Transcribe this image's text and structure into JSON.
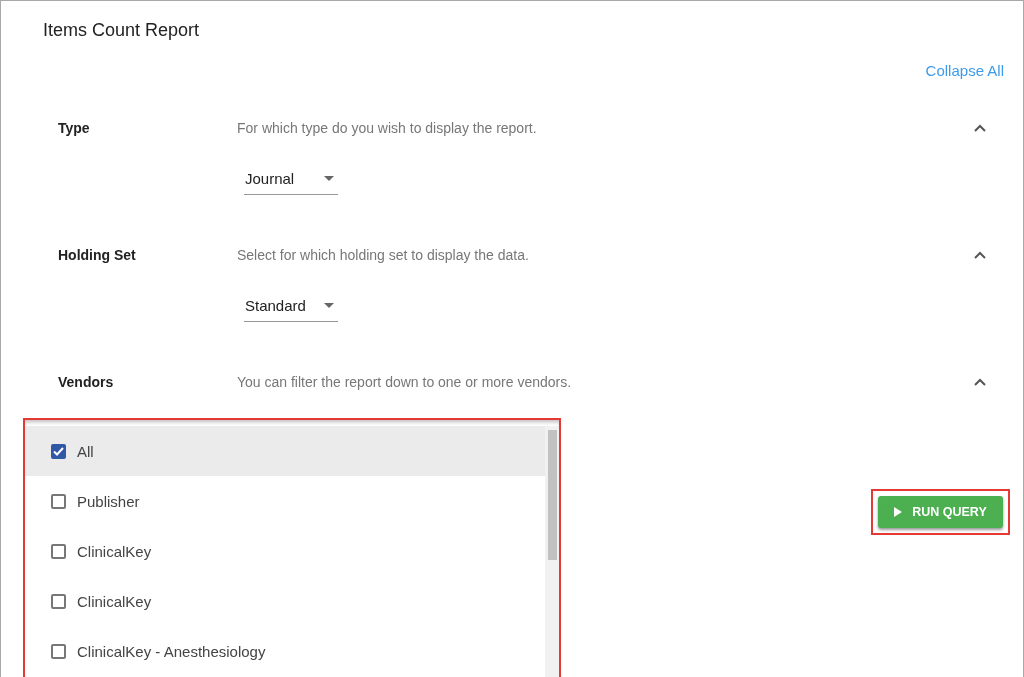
{
  "title": "Items Count Report",
  "collapse_all": "Collapse All",
  "sections": [
    {
      "label": "Type",
      "description": "For which type do you wish to display the report.",
      "expanded": true,
      "dropdown": {
        "value": "Journal"
      }
    },
    {
      "label": "Holding Set",
      "description": "Select for which holding set to display the data.",
      "expanded": true,
      "dropdown": {
        "value": "Standard"
      }
    },
    {
      "label": "Vendors",
      "description": "You can filter the report down to one or more vendors.",
      "expanded": true
    }
  ],
  "vendor_list": [
    {
      "label": "All",
      "checked": true,
      "highlighted": true
    },
    {
      "label": "Publisher",
      "checked": false,
      "highlighted": false
    },
    {
      "label": "ClinicalKey",
      "checked": false,
      "highlighted": false
    },
    {
      "label": "ClinicalKey",
      "checked": false,
      "highlighted": false
    },
    {
      "label": "ClinicalKey - Anesthesiology",
      "checked": false,
      "highlighted": false
    }
  ],
  "run_button": "RUN QUERY"
}
